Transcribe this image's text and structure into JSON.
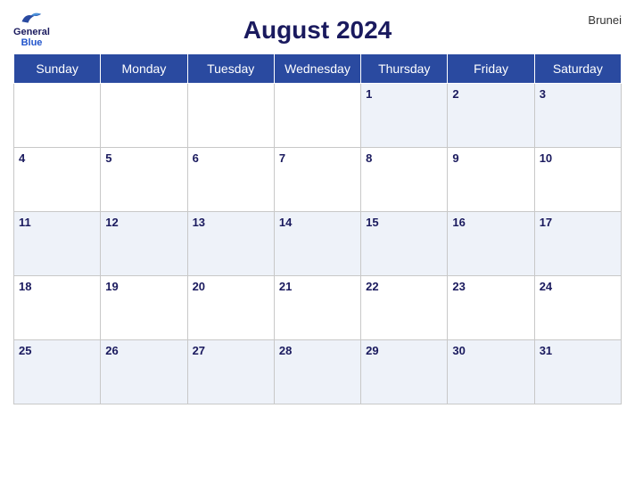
{
  "header": {
    "title": "August 2024",
    "country": "Brunei",
    "logo": {
      "line1": "General",
      "line2": "Blue"
    }
  },
  "days_of_week": [
    "Sunday",
    "Monday",
    "Tuesday",
    "Wednesday",
    "Thursday",
    "Friday",
    "Saturday"
  ],
  "weeks": [
    [
      null,
      null,
      null,
      null,
      1,
      2,
      3
    ],
    [
      4,
      5,
      6,
      7,
      8,
      9,
      10
    ],
    [
      11,
      12,
      13,
      14,
      15,
      16,
      17
    ],
    [
      18,
      19,
      20,
      21,
      22,
      23,
      24
    ],
    [
      25,
      26,
      27,
      28,
      29,
      30,
      31
    ]
  ],
  "colors": {
    "header_bg": "#2a4aa0",
    "header_text": "#ffffff",
    "title_color": "#1a1a5e",
    "row_odd_bg": "#dce6f5",
    "row_even_bg": "#ffffff"
  }
}
